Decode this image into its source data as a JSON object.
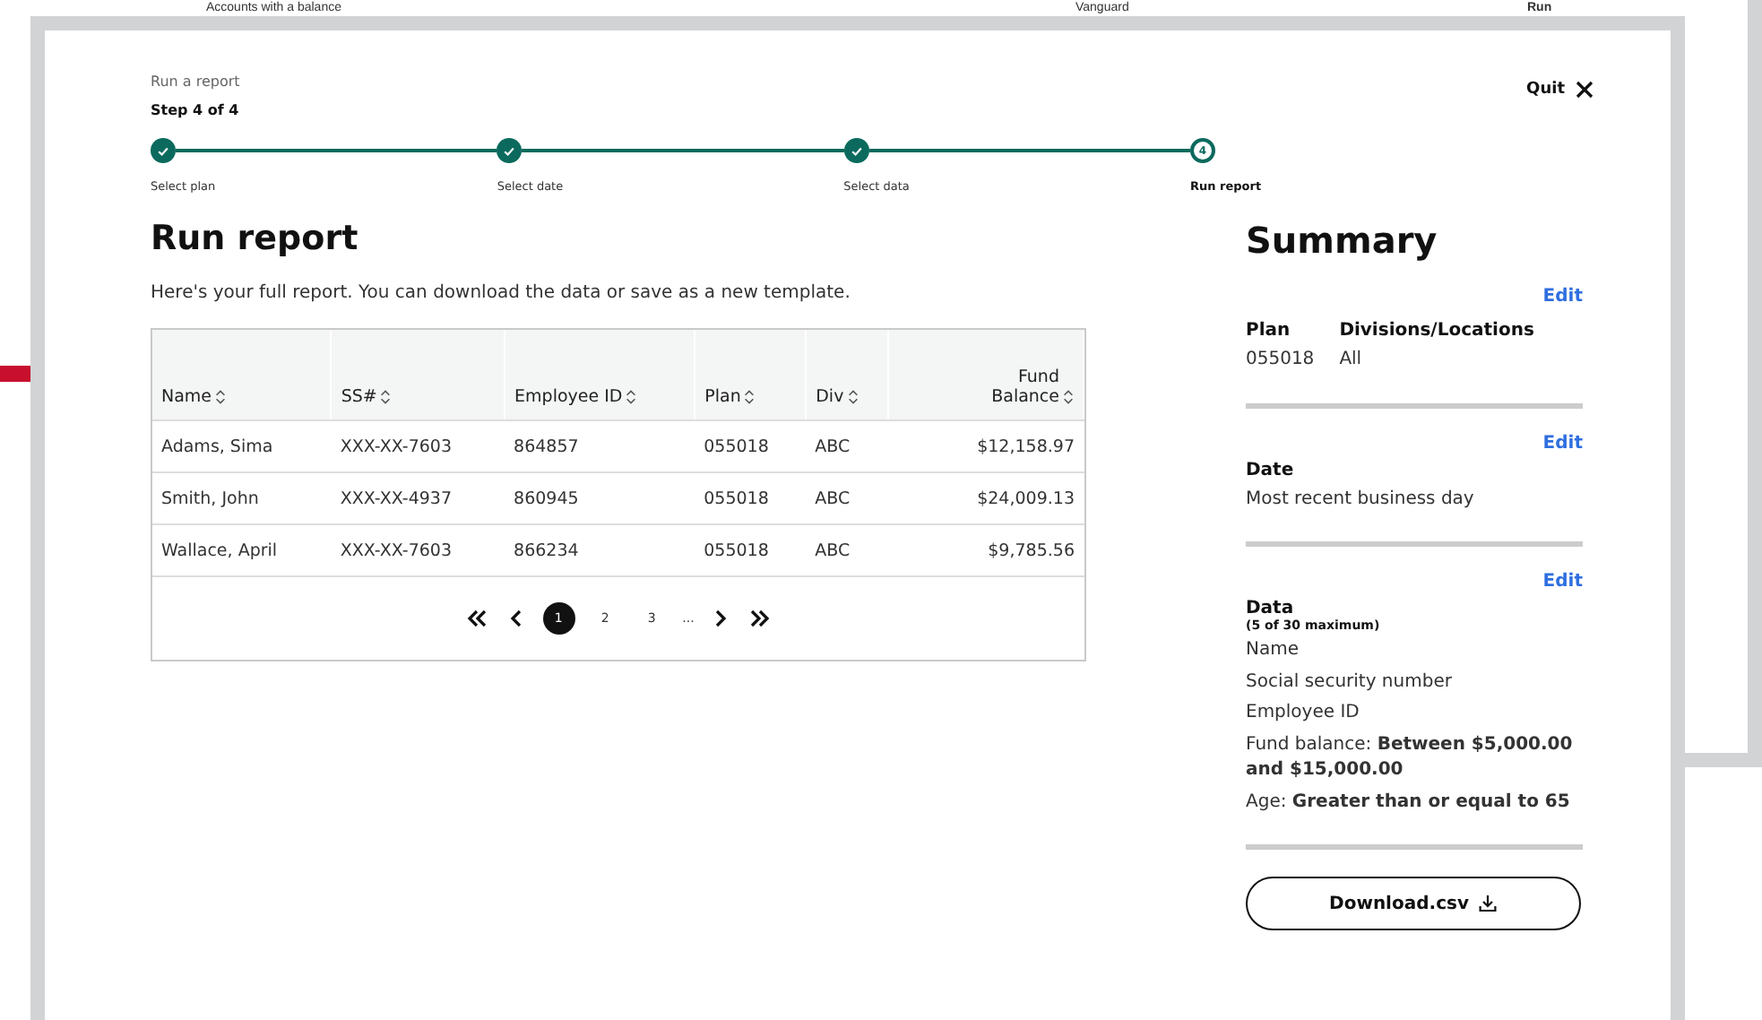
{
  "background_page": {
    "row": [
      "Accounts with a balance",
      "Vanguard",
      "Run"
    ]
  },
  "modal": {
    "breadcrumb": "Run a report",
    "step_text": "Step 4 of 4",
    "quit": "Quit",
    "steps": [
      {
        "label": "Select plan",
        "completed": true,
        "selected": false
      },
      {
        "label": "Select date",
        "completed": true,
        "selected": false
      },
      {
        "label": "Select data",
        "completed": true,
        "selected": false
      },
      {
        "label": "Run report",
        "completed": false,
        "selected": true,
        "number": "4"
      }
    ],
    "title": "Run report",
    "intro": "Here's your full report. You can download the data or save as a new template.",
    "table": {
      "columns": [
        {
          "label": "Name",
          "right_aligned": false
        },
        {
          "label": "SS#",
          "right_aligned": false
        },
        {
          "label": "Employee ID",
          "right_aligned": false
        },
        {
          "label": "Plan",
          "right_aligned": false
        },
        {
          "label": "Div",
          "right_aligned": false
        },
        {
          "label": "Fund Balance",
          "right_aligned": true
        }
      ],
      "rows": [
        [
          "Adams, Sima",
          "XXX-XX-7603",
          "864857",
          "055018",
          "ABC",
          "$12,158.97"
        ],
        [
          "Smith, John",
          "XXX-XX-4937",
          "860945",
          "055018",
          "ABC",
          "$24,009.13"
        ],
        [
          "Wallace, April",
          "XXX-XX-7603",
          "866234",
          "055018",
          "ABC",
          "$9,785.56"
        ]
      ]
    },
    "pagination": {
      "pages": [
        {
          "label": "1",
          "selected": true
        },
        {
          "label": "2",
          "selected": false
        },
        {
          "label": "3",
          "selected": false
        }
      ],
      "ellipsis": "..."
    },
    "summary": {
      "title": "Summary",
      "sections": [
        {
          "edit": "Edit",
          "columns": [
            {
              "heading": "Plan",
              "value": "055018"
            },
            {
              "heading": "Divisions/Locations",
              "value": "All"
            }
          ]
        },
        {
          "edit": "Edit",
          "heading": "Date",
          "lines": [
            "Most recent business day"
          ]
        },
        {
          "edit": "Edit",
          "heading": "Data",
          "note": "(5 of 30 maximum)",
          "lines": [
            "Name",
            "Social security number",
            "Employee ID",
            "Fund balance: **Between $5,000.00 and $15,000.00**",
            "Age: **Greater than or equal to 65**"
          ]
        }
      ],
      "download": "Download.csv"
    }
  }
}
